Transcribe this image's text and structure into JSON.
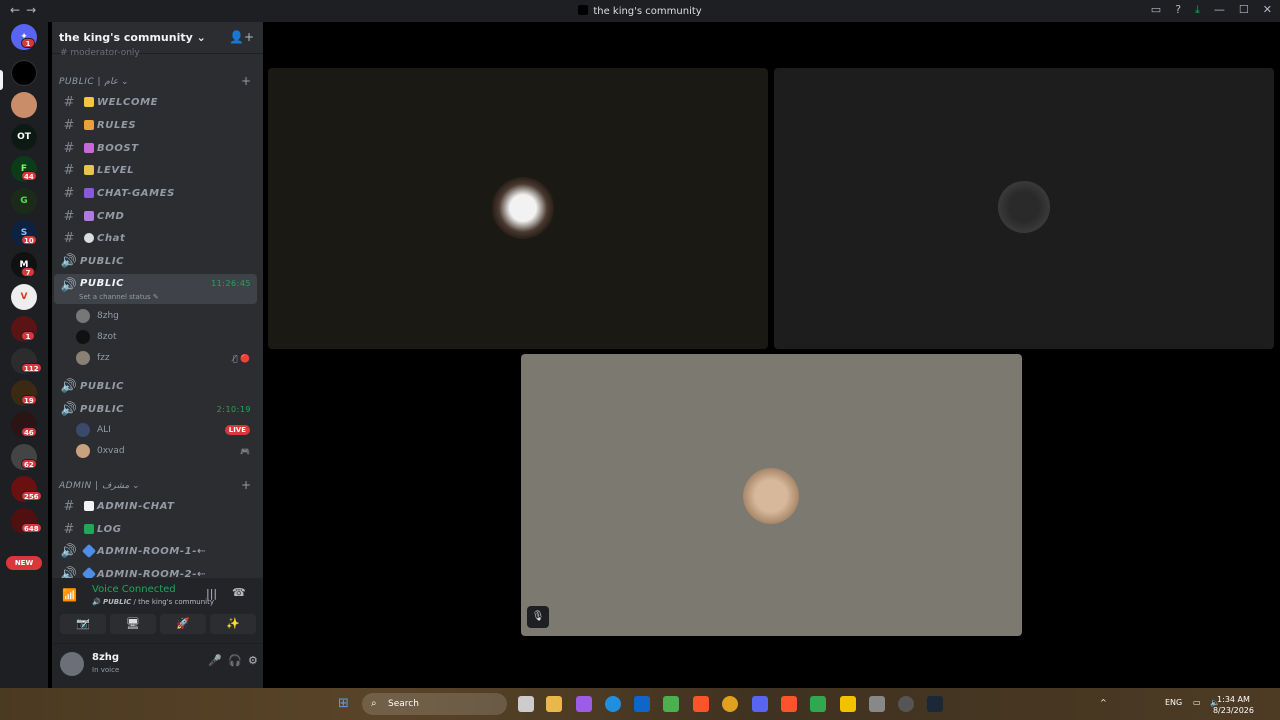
{
  "window": {
    "title": "the king's community",
    "nav_back": "←",
    "nav_forward": "→",
    "controls": [
      "▭",
      "?",
      "⤓",
      "—",
      "☐",
      "✕"
    ]
  },
  "guilds": {
    "badges": [
      "1",
      "44",
      "10",
      "7",
      "1",
      "112",
      "19",
      "46",
      "62",
      "256",
      "648"
    ],
    "new_label": "NEW",
    "abbrevs": [
      "OT"
    ]
  },
  "server": {
    "name": "the king's community",
    "name_chevron": "⌄",
    "cutoff_channel": "moderator-only"
  },
  "categories": [
    {
      "label": "PUBLIC | عام ⌄"
    },
    {
      "label": "ADMIN | مشرف ⌄"
    }
  ],
  "channels": [
    {
      "symbol": "#",
      "label": "WELCOME",
      "emoji": "👋"
    },
    {
      "symbol": "#",
      "label": "RULES",
      "emoji": "📜"
    },
    {
      "symbol": "#",
      "label": "BOOST",
      "emoji": "🟣"
    },
    {
      "symbol": "#",
      "label": "LEVEL",
      "emoji": "🟡"
    },
    {
      "symbol": "#",
      "label": "CHAT-GAMES",
      "emoji": "🟪"
    },
    {
      "symbol": "#",
      "label": "CMD",
      "emoji": "🟣"
    },
    {
      "symbol": "#",
      "label": "Chat",
      "emoji": "💬"
    },
    {
      "symbol": "🔊",
      "label": "PUBLIC",
      "emoji": "🔊"
    },
    {
      "symbol": "🔊",
      "label": "PUBLIC",
      "emoji": "🔊",
      "time": "11:26:45",
      "status": "Set a channel status ✎"
    },
    {
      "symbol": "🔊",
      "label": "PUBLIC",
      "emoji": "🔊"
    },
    {
      "symbol": "🔊",
      "label": "PUBLIC",
      "emoji": "🔊",
      "time": "2:10:19"
    },
    {
      "symbol": "#",
      "label": "ADMIN-CHAT",
      "emoji": "📄"
    },
    {
      "symbol": "#",
      "label": "LOG",
      "emoji": "✅"
    },
    {
      "symbol": "🔊",
      "label": "ADMIN-ROOM-1-⇠",
      "emoji": "🔷"
    },
    {
      "symbol": "🔊",
      "label": "ADMIN-ROOM-2-⇠",
      "emoji": "🔷"
    }
  ],
  "voice_users": [
    {
      "name": "8zhg"
    },
    {
      "name": "8zot"
    },
    {
      "name": "fzz",
      "icons": "🎙̸ 🔴"
    },
    {
      "name": "ALI",
      "live": "LIVE"
    },
    {
      "name": "0xvad",
      "icons": "🎮"
    }
  ],
  "voice_panel": {
    "status": "Voice Connected",
    "channel": "PUBLIC",
    "server": " / the king's community",
    "buttons": [
      "📷̸",
      "🖥",
      "🚀",
      "✨"
    ]
  },
  "user_panel": {
    "name": "8zhg",
    "status": "In voice",
    "controls": [
      "🎤",
      "🎧",
      "⚙"
    ]
  },
  "stage": {
    "tile_count": 3
  },
  "taskbar": {
    "search_label": "Search",
    "lang": "ENG",
    "time": "1:34 AM",
    "date": "8/23/2026"
  },
  "colors": {
    "accent_green": "#23a55a",
    "badge_red": "#da373c",
    "sidebar": "#2b2d31",
    "rail": "#1e1f22"
  }
}
